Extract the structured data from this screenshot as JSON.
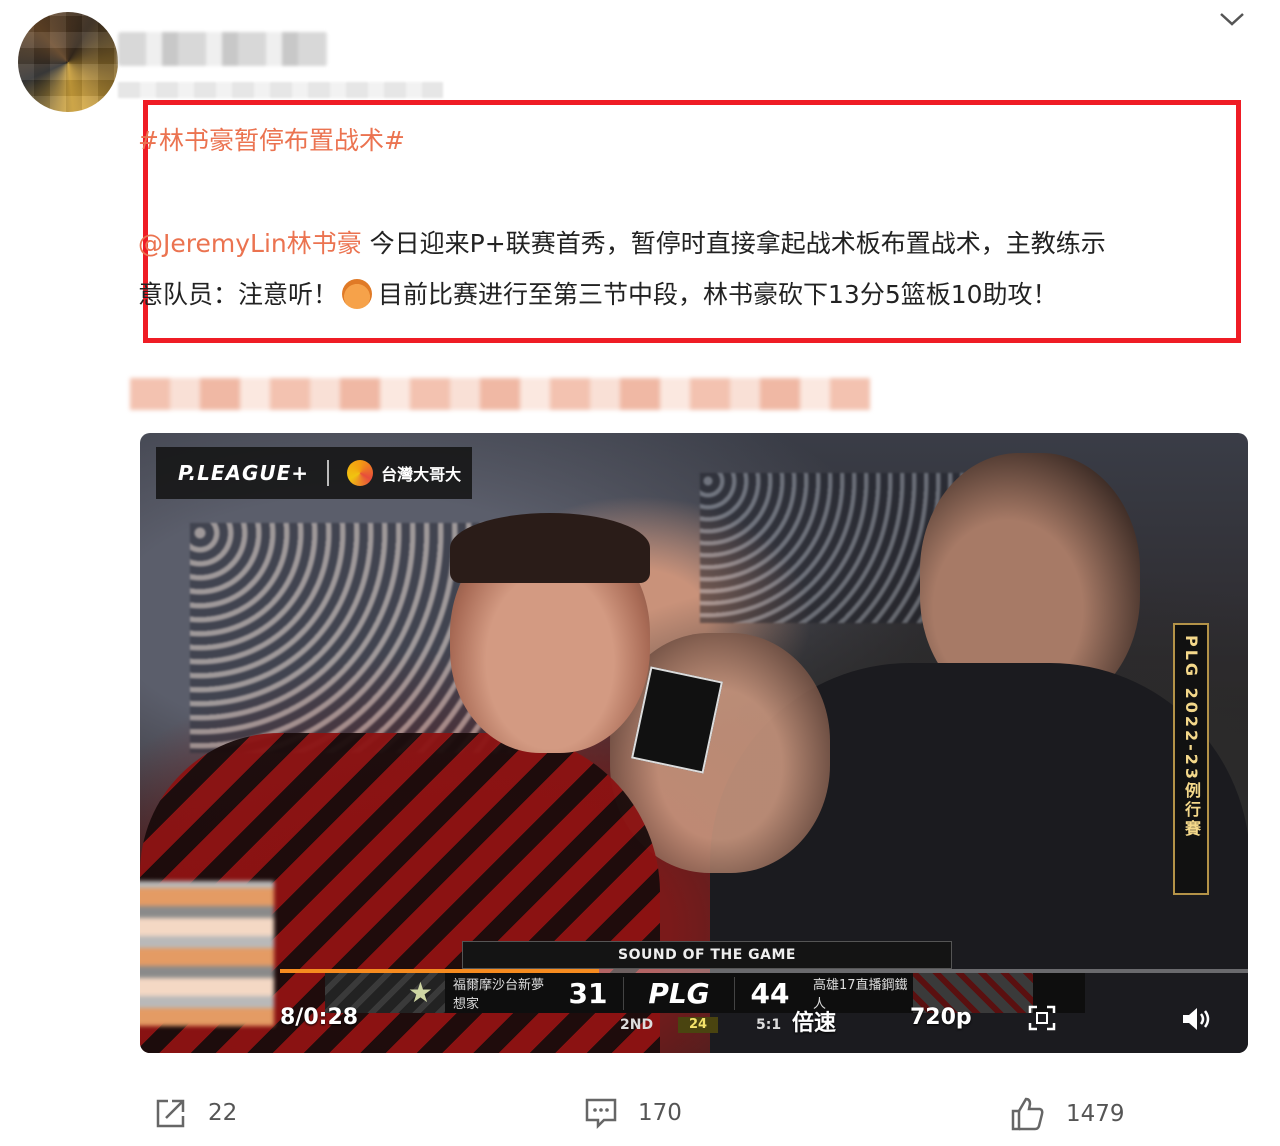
{
  "post": {
    "hashtag": "#林书豪暂停布置战术#",
    "mention": "@JeremyLin林书豪",
    "text_line1": " 今日迎来P+联赛首秀，暂停时直接拿起战术板布置战术，主教练示",
    "text_line2a": "意队员：注意听！",
    "text_line2b": "目前比赛进行至第三节中段，林书豪砍下13分5篮板10助攻！"
  },
  "video": {
    "league_logo": "P.LEAGUE+",
    "channel": "台灣大哥大",
    "side_banner": "PLG 2022-23例行賽",
    "scoreboard": {
      "label": "SOUND OF THE GAME",
      "home_team": "福爾摩沙台新夢想家",
      "home_score": "31",
      "league": "PLG",
      "away_score": "44",
      "away_team": "高雄17直播鋼鐵人",
      "period": "2ND",
      "shot_clock": "24",
      "time_prefix": "5:1"
    },
    "controls": {
      "time": "8/0:28",
      "speed": "倍速",
      "quality": "720p",
      "progress_fraction": 0.33
    }
  },
  "actions": {
    "share_count": "22",
    "comment_count": "170",
    "like_count": "1479"
  },
  "icons": {
    "chevron": "chevron-down-icon",
    "share": "share-icon",
    "comment": "comment-icon",
    "like": "thumbs-up-icon",
    "volume": "volume-icon",
    "fullscreen": "fullscreen-icon"
  },
  "colors": {
    "link": "#eb7350",
    "highlight_border": "#ef1c25",
    "progress": "#f68b1f"
  }
}
